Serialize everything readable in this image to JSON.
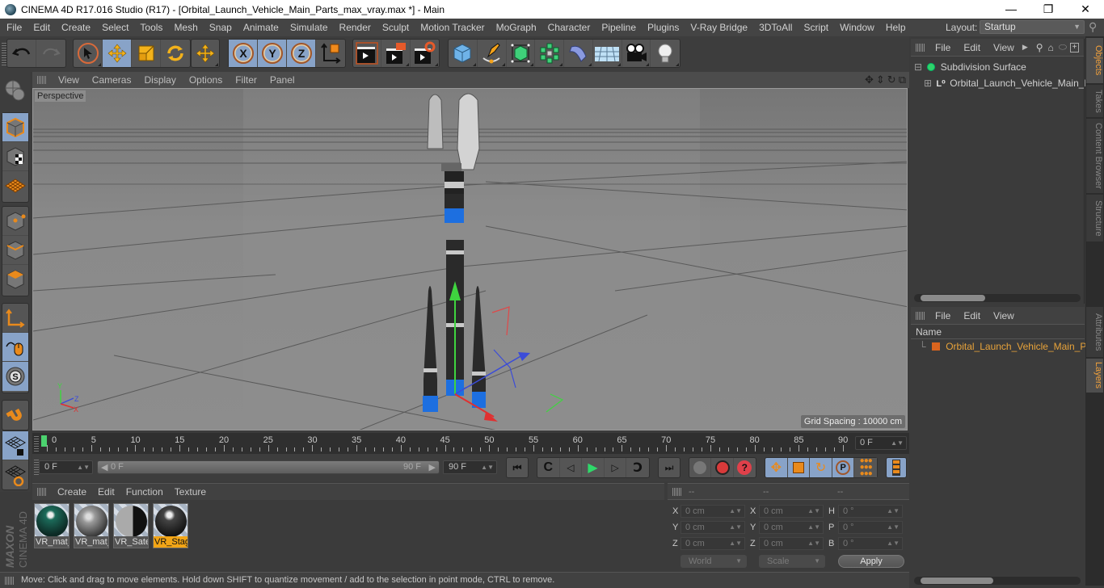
{
  "window": {
    "title": "CINEMA 4D R17.016 Studio (R17) - [Orbital_Launch_Vehicle_Main_Parts_max_vray.max *] - Main",
    "minimize": "—",
    "maximize": "❐",
    "close": "✕"
  },
  "menubar": {
    "items": [
      "File",
      "Edit",
      "Create",
      "Select",
      "Tools",
      "Mesh",
      "Snap",
      "Animate",
      "Simulate",
      "Render",
      "Sculpt",
      "Motion Tracker",
      "MoGraph",
      "Character",
      "Pipeline",
      "Plugins",
      "V-Ray Bridge",
      "3DToAll",
      "Script",
      "Window",
      "Help"
    ],
    "layout_label": "Layout:",
    "layout_value": "Startup"
  },
  "toolbar": {
    "icons": [
      "undo-icon",
      "redo-icon",
      "live-selection-icon",
      "move-icon",
      "scale-icon",
      "rotate-icon",
      "recent-tool-icon",
      "x-axis-lock-icon",
      "y-axis-lock-icon",
      "z-axis-lock-icon",
      "coordinate-system-icon",
      "render-view-icon",
      "render-to-picture-viewer-icon",
      "render-settings-icon",
      "cube-icon",
      "pen-icon",
      "subdivision-surface-icon",
      "cloner-icon",
      "deformer-icon",
      "floor-icon",
      "camera-icon",
      "light-icon"
    ],
    "axis_labels": [
      "X",
      "Y",
      "Z"
    ]
  },
  "left_tools": [
    "make-editable-icon",
    "model-mode-icon",
    "texture-mode-icon",
    "workplane-mode-icon",
    "points-mode-icon",
    "edges-mode-icon",
    "polygons-mode-icon",
    "axis-mode-icon",
    "tweak-mode-icon",
    "solo-mode-icon",
    "snap-icon",
    "workplane-lock-icon",
    "workplane-axis-icon"
  ],
  "viewport": {
    "menu": [
      "View",
      "Cameras",
      "Display",
      "Options",
      "Filter",
      "Panel"
    ],
    "label": "Perspective",
    "grid_spacing": "Grid Spacing : 10000 cm",
    "axis": {
      "x": "X",
      "y": "Y",
      "z": "Z"
    }
  },
  "timeline": {
    "ticks": [
      "0",
      "5",
      "10",
      "15",
      "20",
      "25",
      "30",
      "35",
      "40",
      "45",
      "50",
      "55",
      "60",
      "65",
      "70",
      "75",
      "80",
      "85",
      "90"
    ],
    "current_frame": "0 F",
    "start_field": "0 F",
    "slider_start": "0 F",
    "slider_end": "90 F",
    "end_field": "90 F",
    "playhead_fraction": 0
  },
  "transport": {
    "buttons": [
      "go-to-start-icon",
      "previous-keyframe-icon",
      "previous-frame-icon",
      "play-icon",
      "next-frame-icon",
      "next-keyframe-icon",
      "go-to-end-icon",
      "record-keys-icon",
      "autokey-icon",
      "keyframe-selection-icon",
      "move-key-icon",
      "scale-key-icon",
      "rotate-key-icon",
      "param-key-icon",
      "pla-key-icon",
      "timeline-icon"
    ],
    "param_label": "P"
  },
  "materials": {
    "menu": [
      "Create",
      "Edit",
      "Function",
      "Texture"
    ],
    "items": [
      {
        "name": "VR_mat_",
        "selected": false
      },
      {
        "name": "VR_mat_",
        "selected": false
      },
      {
        "name": "VR_Sate",
        "selected": false
      },
      {
        "name": "VR_Stag",
        "selected": true
      }
    ],
    "brand_top": "MAXON",
    "brand_bottom": "CINEMA 4D"
  },
  "coordinates": {
    "headers": [
      "--",
      "--",
      "--"
    ],
    "position": [
      {
        "axis": "X",
        "value": "0 cm"
      },
      {
        "axis": "Y",
        "value": "0 cm"
      },
      {
        "axis": "Z",
        "value": "0 cm"
      }
    ],
    "size": [
      {
        "axis": "X",
        "value": "0 cm"
      },
      {
        "axis": "Y",
        "value": "0 cm"
      },
      {
        "axis": "Z",
        "value": "0 cm"
      }
    ],
    "rotation": [
      {
        "axis": "H",
        "value": "0 °"
      },
      {
        "axis": "P",
        "value": "0 °"
      },
      {
        "axis": "B",
        "value": "0 °"
      }
    ],
    "mode": "World",
    "scale_mode": "Scale",
    "apply": "Apply"
  },
  "status": "Move: Click and drag to move elements. Hold down SHIFT to quantize movement / add to the selection in point mode, CTRL to remove.",
  "objects_panel": {
    "menu": [
      "File",
      "Edit",
      "View"
    ],
    "tree": [
      {
        "name": "Subdivision Surface",
        "level": 0
      },
      {
        "name": "Orbital_Launch_Vehicle_Main_Pa",
        "level": 1
      }
    ]
  },
  "layers_panel": {
    "menu": [
      "File",
      "Edit",
      "View"
    ],
    "column": "Name",
    "items": [
      {
        "name": "Orbital_Launch_Vehicle_Main_Par",
        "color": "#d9641e"
      }
    ]
  },
  "right_tabs": {
    "top": [
      "Objects",
      "Takes",
      "Content Browser",
      "Structure"
    ],
    "bottom": [
      "Attributes",
      "Layers"
    ]
  },
  "colors": {
    "accent_orange": "#f2a516",
    "selection_blue": "#88a3c8",
    "layer_text": "#e8a33a"
  }
}
